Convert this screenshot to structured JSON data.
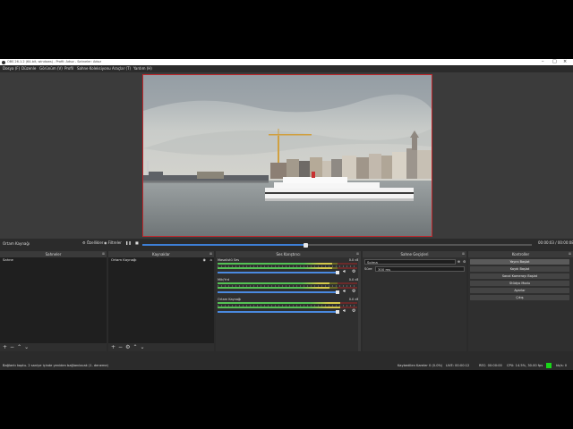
{
  "window": {
    "title": "OBS 26.1.2 (64-bit, windows) - Profil: Adsız - Sahneler: Adsız"
  },
  "menu": [
    "Dosya (F)",
    "Düzenle",
    "Görünüm (V)",
    "Profil",
    "Sahne Koleksiyonu",
    "Araçlar (T)",
    "Yardım (H)"
  ],
  "player": {
    "source_label": "Ortam Kaynağı",
    "settings_label": "Özellikler",
    "filters_label": "Filtreler",
    "progress": 0.42,
    "time": "00:00:03 / 00:00:08"
  },
  "docks": {
    "scenes": {
      "title": "Sahneler",
      "items": [
        "Sahne"
      ]
    },
    "sources": {
      "title": "Kaynaklar",
      "items": [
        "Ortam Kaynağı"
      ]
    },
    "mixer": {
      "title": "Ses Karıştırıcı",
      "channels": [
        {
          "name": "Masaüstü Ses",
          "db": "0.0 dB",
          "level": 0.82
        },
        {
          "name": "Mik/Yrd",
          "db": "0.0 dB",
          "level": 0.8
        },
        {
          "name": "Ortam Kaynağı",
          "db": "0.0 dB",
          "level": 0.88
        }
      ]
    },
    "transitions": {
      "title": "Sahne Geçişleri",
      "transition_value": "Solma",
      "duration_label": "Süre",
      "duration_value": "300 ms"
    },
    "controls": {
      "title": "Kontroller",
      "buttons": [
        "Yayını Başlat",
        "Kaydı Başlat",
        "Sanal Kamerayı Başlat",
        "Stüdyo Modu",
        "Ayarlar",
        "Çıkış"
      ]
    }
  },
  "status": {
    "message": "Bağlantı koptu. 2 saniye içinde yeniden bağlanılacak (1. deneme)",
    "dropped": "Kaybedilen Kareler 0 (0.0%)",
    "live": "LIVE: 00:00:12",
    "rec": "REC: 00:00:00",
    "cpu": "CPU: 14.5%, 30.00 fps",
    "kb": "kb/s: 0"
  },
  "colors": {
    "accent": "#3d7fd6",
    "preview_border": "#c0282d",
    "status_ok": "#18d818"
  }
}
